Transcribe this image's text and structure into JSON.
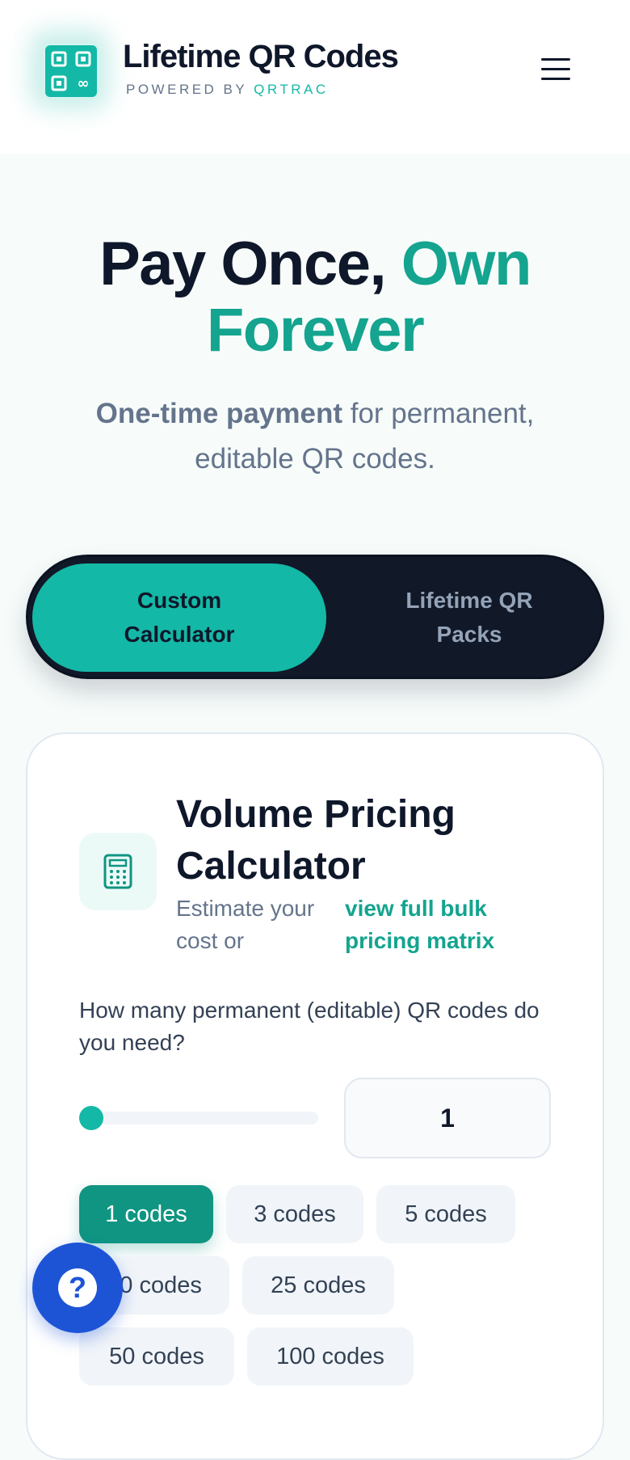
{
  "header": {
    "title": "Lifetime QR Codes",
    "powered_prefix": "POWERED BY",
    "powered_brand": "QRTRAC",
    "menu_icon": "hamburger-menu-icon"
  },
  "hero": {
    "title_dark": "Pay Once,",
    "title_green_1": "Own",
    "title_green_2": "Forever",
    "subtitle_bold": "One-time payment",
    "subtitle_rest": "for permanent, editable QR codes."
  },
  "tabs": {
    "active_label": "Custom Calculator",
    "inactive_label": "Lifetime QR Packs"
  },
  "calculator": {
    "icon": "calculator-icon",
    "title": "Volume Pricing Calculator",
    "desc": "Estimate your cost or",
    "link": "view full bulk pricing matrix",
    "question": "How many permanent (editable) QR codes do you need?",
    "quantity": "1",
    "slider_level": 0,
    "chips": [
      "1 codes",
      "3 codes",
      "5 codes",
      "10 codes",
      "25 codes",
      "50 codes",
      "100 codes"
    ]
  },
  "help": {
    "label": "?",
    "icon": "help-icon"
  },
  "colors": {
    "accent": "#14b8a6",
    "accent_dark": "#0f9582",
    "navy": "#111827",
    "help_blue": "#1d54d6"
  }
}
